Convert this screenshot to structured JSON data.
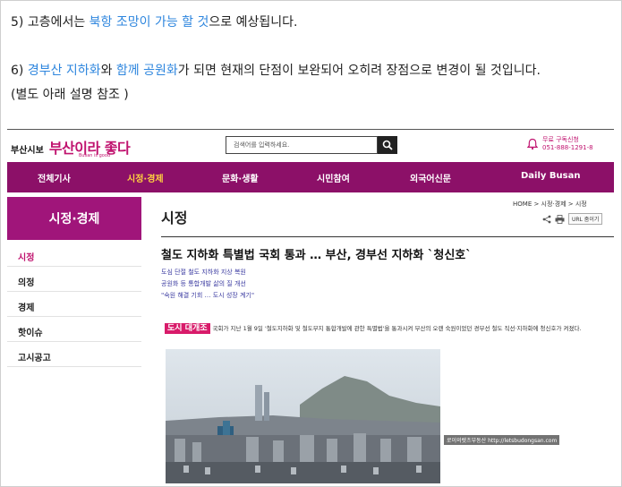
{
  "text": {
    "line5": {
      "prefix": "5) 고층에서는 ",
      "highlight": "북항 조망이 가능 할 것",
      "suffix": "으로 예상됩니다."
    },
    "line6": {
      "prefix": "6) ",
      "hl1": "경부산 지하화",
      "mid1": "와 ",
      "hl2": "함께 공원화",
      "suffix": "가 되면 현재의 단점이 보완되어 오히려 장점으로 변경이 될 것입니다."
    },
    "line6b": "(별도 아래 설명 참조 )"
  },
  "screenshot": {
    "brand": {
      "small": "부산시보",
      "main": "부산이라 좋다",
      "sub": "Busan is good"
    },
    "search": {
      "placeholder": "검색어를 입력하세요."
    },
    "subscribe": {
      "line1": "무료 구독신청",
      "line2": "051-888-1291-8"
    },
    "gnb": [
      "전체기사",
      "시정·경제",
      "문화·생활",
      "시민참여",
      "외국어신문",
      "Daily Busan"
    ],
    "gnb_active": "시정·경제",
    "lnb_title": "시정·경제",
    "lnb": [
      "시정",
      "의정",
      "경제",
      "핫이슈",
      "고시공고"
    ],
    "lnb_active": "시정",
    "page_title": "시정",
    "breadcrumb": "HOME > 시정·경제 > 시정",
    "url_button": "URL 줌이기",
    "headline": "철도 지하화 특별법 국회 통과 … 부산, 경부선 지하화 `청신호`",
    "subheads": [
      "도심 단절 철도 지하화 지상 복원",
      "공원화 등 통합개발 삶의 질 개선",
      "\"숙원 해결 기회 … 도시 성장 계기\""
    ],
    "lede_tag": "도시 대개조",
    "lede_text": "국회가 지난 1월 9일 '철도지하화 및 철도부지 통합개발에 관한 특별법'을 통과시켜 부산의 오랜 숙원이었던 경부선 철도 직선·지하화에 청신호가 켜졌다.",
    "photo_caption": "로이의렛츠부동산 http://letsbudongsan.com"
  },
  "colors": {
    "accent": "#c0136f",
    "nav_bg": "#8c1068",
    "highlight_text": "#2e86de"
  }
}
